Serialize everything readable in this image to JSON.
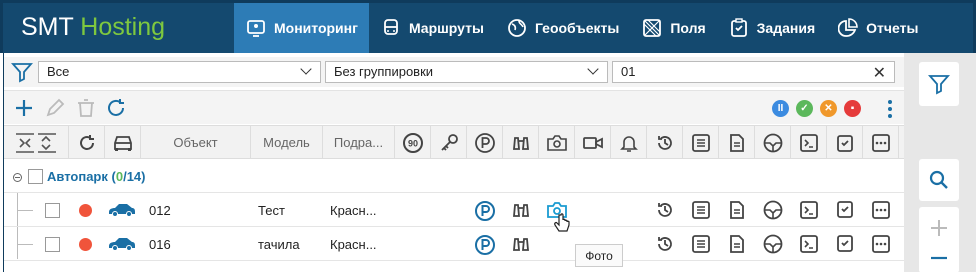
{
  "brand": {
    "part1": "SMT",
    "part2": "Hosting"
  },
  "nav": [
    {
      "label": "Мониторинг",
      "icon": "monitor-pin-icon",
      "active": true
    },
    {
      "label": "Маршруты",
      "icon": "bus-icon",
      "active": false
    },
    {
      "label": "Геообъекты",
      "icon": "globe-icon",
      "active": false
    },
    {
      "label": "Поля",
      "icon": "field-icon",
      "active": false
    },
    {
      "label": "Задания",
      "icon": "clipboard-check-icon",
      "active": false
    },
    {
      "label": "Отчеты",
      "icon": "chart-icon",
      "active": false
    }
  ],
  "filters": {
    "scope": "Все",
    "grouping": "Без группировки",
    "search": "01"
  },
  "header": {
    "object": "Объект",
    "model": "Модель",
    "division": "Подра...",
    "speed_badge": "90"
  },
  "group": {
    "name": "Автопарк",
    "online": "0",
    "total": "14"
  },
  "rows": [
    {
      "object": "012",
      "model": "Тест",
      "division": "Красн..."
    },
    {
      "object": "016",
      "model": "тачила",
      "division": "Красн..."
    }
  ],
  "tooltip": "Фото",
  "colors": {
    "topbar": "#14496f",
    "active_tab": "#2d7cb6",
    "brand_green": "#7ec83f",
    "icon_blue": "#1a6fa5",
    "status_red": "#f0543b"
  }
}
